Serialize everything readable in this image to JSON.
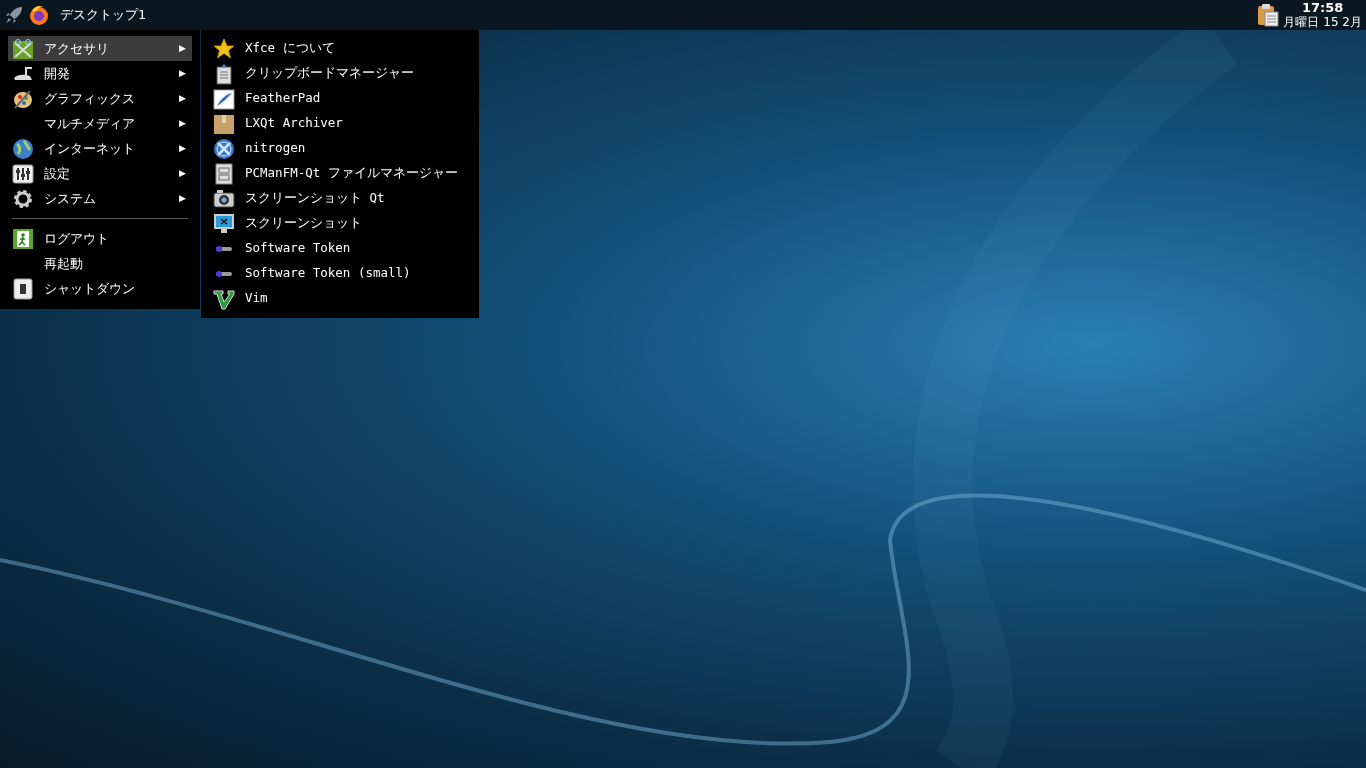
{
  "taskbar": {
    "workspace": "デスクトップ1",
    "clock": {
      "time": "17:58",
      "date": "月曜日 15 2月"
    }
  },
  "menu": {
    "items": [
      {
        "kind": "category",
        "label": "アクセサリ",
        "arrow": "▶",
        "selected": true
      },
      {
        "kind": "category",
        "label": "開発",
        "arrow": "▶",
        "selected": false
      },
      {
        "kind": "category",
        "label": "グラフィックス",
        "arrow": "▶",
        "selected": false
      },
      {
        "kind": "category",
        "label": "マルチメディア",
        "arrow": "▶",
        "selected": false
      },
      {
        "kind": "category",
        "label": "インターネット",
        "arrow": "▶",
        "selected": false
      },
      {
        "kind": "category",
        "label": "設定",
        "arrow": "▶",
        "selected": false
      },
      {
        "kind": "category",
        "label": "システム",
        "arrow": "▶",
        "selected": false
      },
      {
        "kind": "separator"
      },
      {
        "kind": "action",
        "label": "ログアウト",
        "selected": false
      },
      {
        "kind": "action",
        "label": "再起動",
        "selected": false
      },
      {
        "kind": "action",
        "label": "シャットダウン",
        "selected": false
      }
    ]
  },
  "submenu": {
    "items": [
      {
        "label": "Xfce について"
      },
      {
        "label": "クリップボードマネージャー"
      },
      {
        "label": "FeatherPad"
      },
      {
        "label": "LXQt Archiver"
      },
      {
        "label": "nitrogen"
      },
      {
        "label": "PCManFM-Qt ファイルマネージャー"
      },
      {
        "label": "スクリーンショット Qt"
      },
      {
        "label": "スクリーンショット"
      },
      {
        "label": "Software Token"
      },
      {
        "label": "Software Token (small)"
      },
      {
        "label": "Vim"
      }
    ]
  }
}
